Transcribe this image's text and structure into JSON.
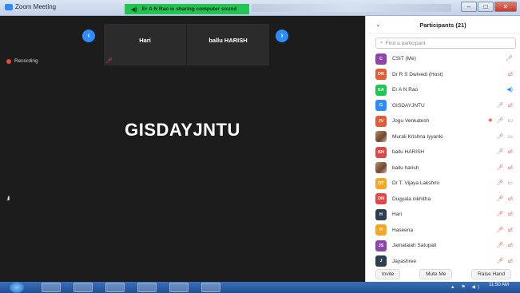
{
  "window": {
    "title": "Zoom Meeting",
    "share_banner": "Er A N Rao is sharing computer sound"
  },
  "meeting": {
    "thumbnails": [
      {
        "name": "Hari"
      },
      {
        "name": "ballu HARISH"
      }
    ],
    "recording_label": "Recording",
    "active_speaker": "GISDAYJNTU",
    "signal": ".ıll"
  },
  "participants": {
    "title": "Participants (21)",
    "search_placeholder": "Find a participant",
    "list": [
      {
        "initials": "C",
        "name": "CSIT (Me)",
        "color": "#8e44ad",
        "photo": false
      },
      {
        "initials": "DR",
        "name": "Dr R S Dwivedi (Host)",
        "color": "#e05d35",
        "photo": false
      },
      {
        "initials": "EA",
        "name": "Er A N Rao",
        "color": "#23c552",
        "photo": false
      },
      {
        "initials": "G",
        "name": "GISDAYJNTU",
        "color": "#2d8cff",
        "photo": false
      },
      {
        "initials": "JV",
        "name": "Jogu Venkatesh",
        "color": "#e05d35",
        "photo": false
      },
      {
        "initials": "",
        "name": "Murali Krishna Iyyanki",
        "color": "#b98a62",
        "photo": true
      },
      {
        "initials": "BH",
        "name": "ballu HARISH",
        "color": "#e04848",
        "photo": false
      },
      {
        "initials": "",
        "name": "ballu harish",
        "color": "#b98a62",
        "photo": true
      },
      {
        "initials": "DT",
        "name": "Dr T. Vijaya Lakshmi",
        "color": "#f5a623",
        "photo": false
      },
      {
        "initials": "DN",
        "name": "Dugyala nikhitha",
        "color": "#e04848",
        "photo": false
      },
      {
        "initials": "H",
        "name": "Hari",
        "color": "#2c3e50",
        "photo": false
      },
      {
        "initials": "H",
        "name": "Haseena",
        "color": "#f5a623",
        "photo": false
      },
      {
        "initials": "JS",
        "name": "Jamalaiah Satupati",
        "color": "#8e44ad",
        "photo": false
      },
      {
        "initials": "J",
        "name": "Jayashree",
        "color": "#2c3e50",
        "photo": false
      }
    ],
    "footer": {
      "invite": "Invite",
      "mute_me": "Mute Me",
      "raise_hand": "Raise Hand"
    }
  },
  "taskbar": {
    "clock": "11:50 AM"
  }
}
